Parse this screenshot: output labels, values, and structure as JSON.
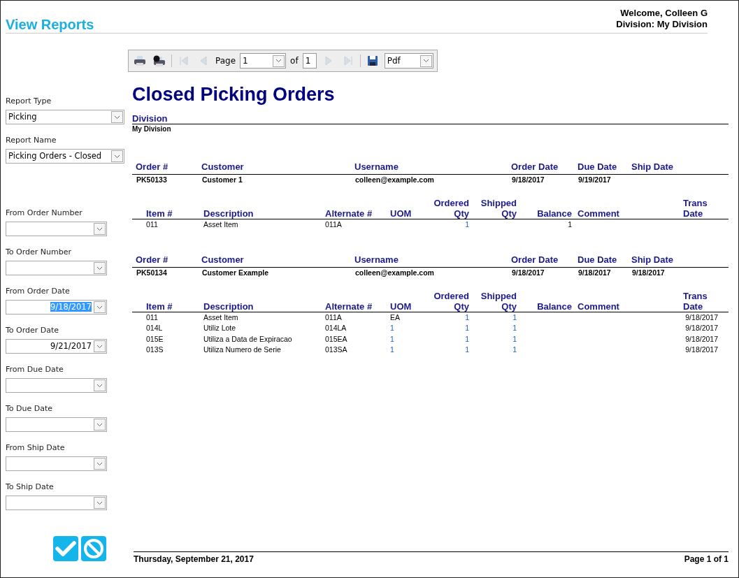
{
  "header": {
    "title": "View Reports",
    "welcome": "Welcome, Colleen G",
    "division": "Division: My Division"
  },
  "filters": [
    {
      "label": "Report Type",
      "kind": "dropdown",
      "value": "Picking"
    },
    {
      "label": "Report Name",
      "kind": "dropdown",
      "value": "Picking Orders - Closed"
    },
    {
      "label": "From Order Number",
      "kind": "combo"
    },
    {
      "label": "To Order Number",
      "kind": "combo"
    },
    {
      "label": "From Order Date",
      "kind": "combo",
      "value": "9/18/2017",
      "highlighted": true
    },
    {
      "label": "To Order Date",
      "kind": "combo",
      "value": "9/21/2017"
    },
    {
      "label": "From Due Date",
      "kind": "combo"
    },
    {
      "label": "To Due Date",
      "kind": "combo"
    },
    {
      "label": "From Ship Date",
      "kind": "combo"
    },
    {
      "label": "To Ship Date",
      "kind": "combo"
    }
  ],
  "toolbar": {
    "page_label": "Page",
    "page": "1",
    "of_label": "of",
    "page_count": "1",
    "format": "Pdf",
    "nav": [
      {
        "kind": "first",
        "disabled": true
      },
      {
        "kind": "prev",
        "disabled": true
      },
      {
        "kind": "next",
        "disabled": true
      },
      {
        "kind": "last",
        "disabled": true
      }
    ]
  },
  "report": {
    "title": "Closed Picking Orders",
    "division_label": "Division",
    "division_value": "My Division",
    "orders": [
      {
        "columns": [
          "Order #",
          "Customer",
          "Username",
          "Order Date",
          "Due Date",
          "Ship Date"
        ],
        "order": {
          "order_no": "PK50133",
          "customer": "Customer 1",
          "username": "colleen@example.com",
          "order_date": "9/18/2017",
          "due_date": "9/19/2017"
        },
        "item_columns": [
          "Item #",
          "Description",
          "Alternate #",
          "UOM",
          "Ordered Qty",
          "Shipped Qty",
          "Balance",
          "Comment",
          "Trans Date"
        ],
        "items": [
          {
            "item": "011",
            "description": "Asset Item",
            "alternate": "011A",
            "ordered_qty": "1",
            "balance": "1"
          }
        ]
      },
      {
        "columns": [
          "Order #",
          "Customer",
          "Username",
          "Order Date",
          "Due Date",
          "Ship Date"
        ],
        "order": {
          "order_no": "PK50134",
          "customer": "Customer Example",
          "username": "colleen@example.com",
          "order_date": "9/18/2017",
          "due_date": "9/18/2017",
          "ship_date": "9/18/2017"
        },
        "item_columns": [
          "Item #",
          "Description",
          "Alternate #",
          "UOM",
          "Ordered Qty",
          "Shipped Qty",
          "Balance",
          "Comment",
          "Trans Date"
        ],
        "items": [
          {
            "item": "011",
            "description": "Asset Item",
            "alternate": "011A",
            "uom": "EA",
            "ordered_qty": "1",
            "shipped_qty": "1",
            "trans_date": "9/18/2017"
          },
          {
            "item": "014L",
            "description": "Utiliz Lote",
            "alternate": "014LA",
            "uom": "1",
            "ordered_qty": "1",
            "shipped_qty": "1",
            "trans_date": "9/18/2017"
          },
          {
            "item": "015E",
            "description": "Utiliza a Data de Expiracao",
            "alternate": "015EA",
            "uom": "1",
            "ordered_qty": "1",
            "shipped_qty": "1",
            "trans_date": "9/18/2017"
          },
          {
            "item": "013S",
            "description": "Utiliza Numero de Serie",
            "alternate": "013SA",
            "uom": "1",
            "ordered_qty": "1",
            "shipped_qty": "1",
            "trans_date": "9/18/2017"
          }
        ]
      }
    ],
    "footer": {
      "date": "Thursday, September 21, 2017",
      "page": "Page 1 of 1"
    }
  }
}
